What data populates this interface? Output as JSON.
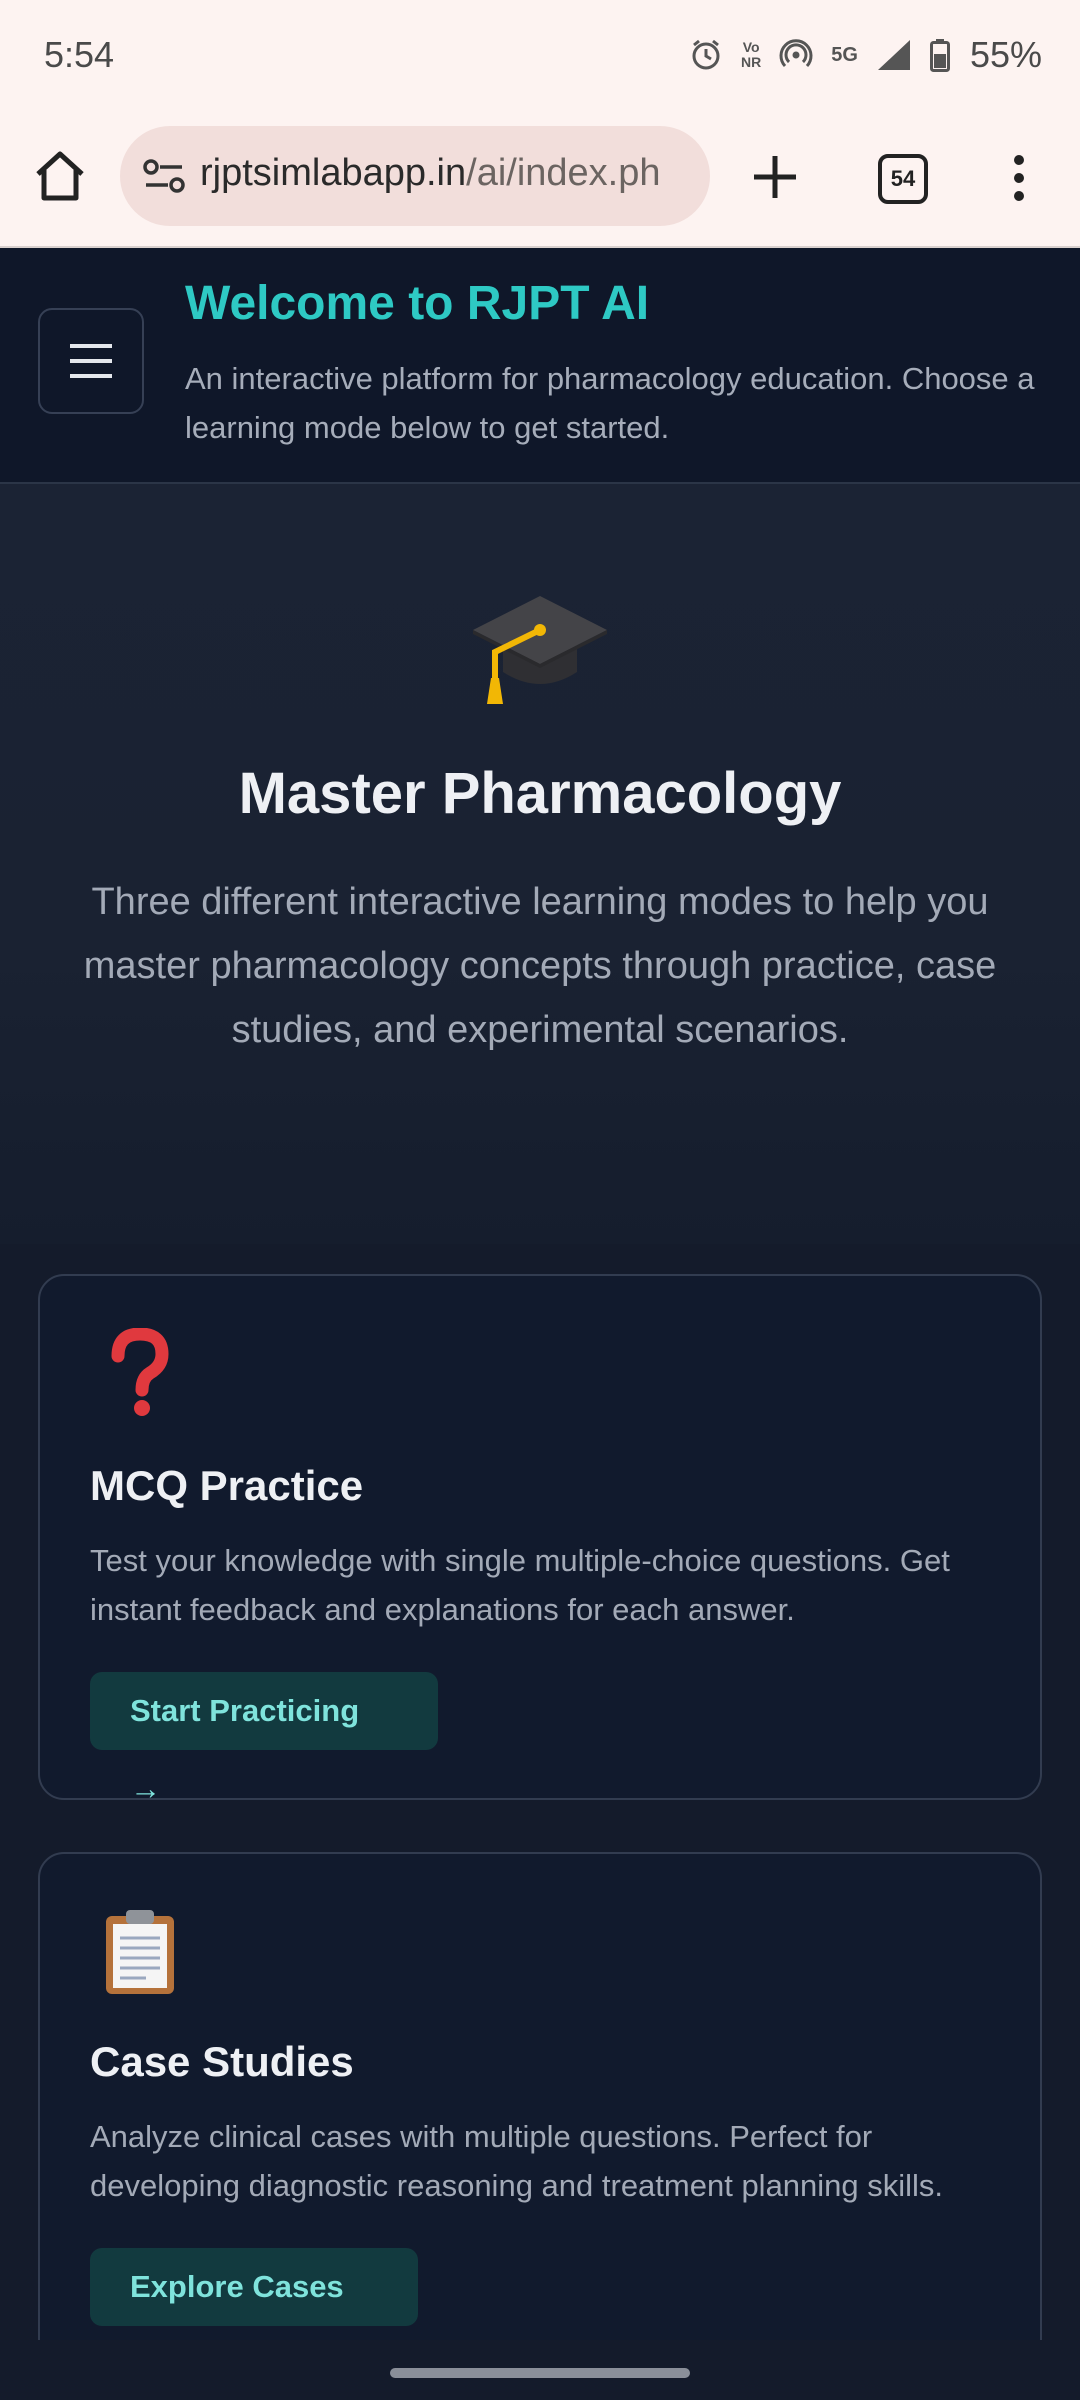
{
  "status_bar": {
    "time": "5:54",
    "vonr_top": "Vo",
    "vonr_bottom": "NR",
    "network": "5G",
    "battery": "55%"
  },
  "browser": {
    "url_host": "rjptsimlabapp.in",
    "url_path": "/ai/index.ph",
    "tab_count": "54"
  },
  "header": {
    "title": "Welcome to RJPT AI",
    "subtitle": "An interactive platform for pharmacology education. Choose a learning mode below to get started."
  },
  "hero": {
    "title": "Master Pharmacology",
    "description": "Three different interactive learning modes to help you master pharmacology concepts through practice, case studies, and experimental scenarios."
  },
  "cards": [
    {
      "icon": "question-mark-icon",
      "title": "MCQ Practice",
      "description": "Test your knowledge with single multiple-choice questions. Get instant feedback and explanations for each answer.",
      "button": "Start Practicing →"
    },
    {
      "icon": "clipboard-icon",
      "title": "Case Studies",
      "description": "Analyze clinical cases with multiple questions. Perfect for developing diagnostic reasoning and treatment planning skills.",
      "button": "Explore Cases →"
    }
  ],
  "colors": {
    "accent": "#2ec9c4",
    "header_bg": "#0f1729",
    "card_bg": "#111a2d",
    "button_bg": "#123a3f",
    "button_text": "#7fe3dc"
  }
}
